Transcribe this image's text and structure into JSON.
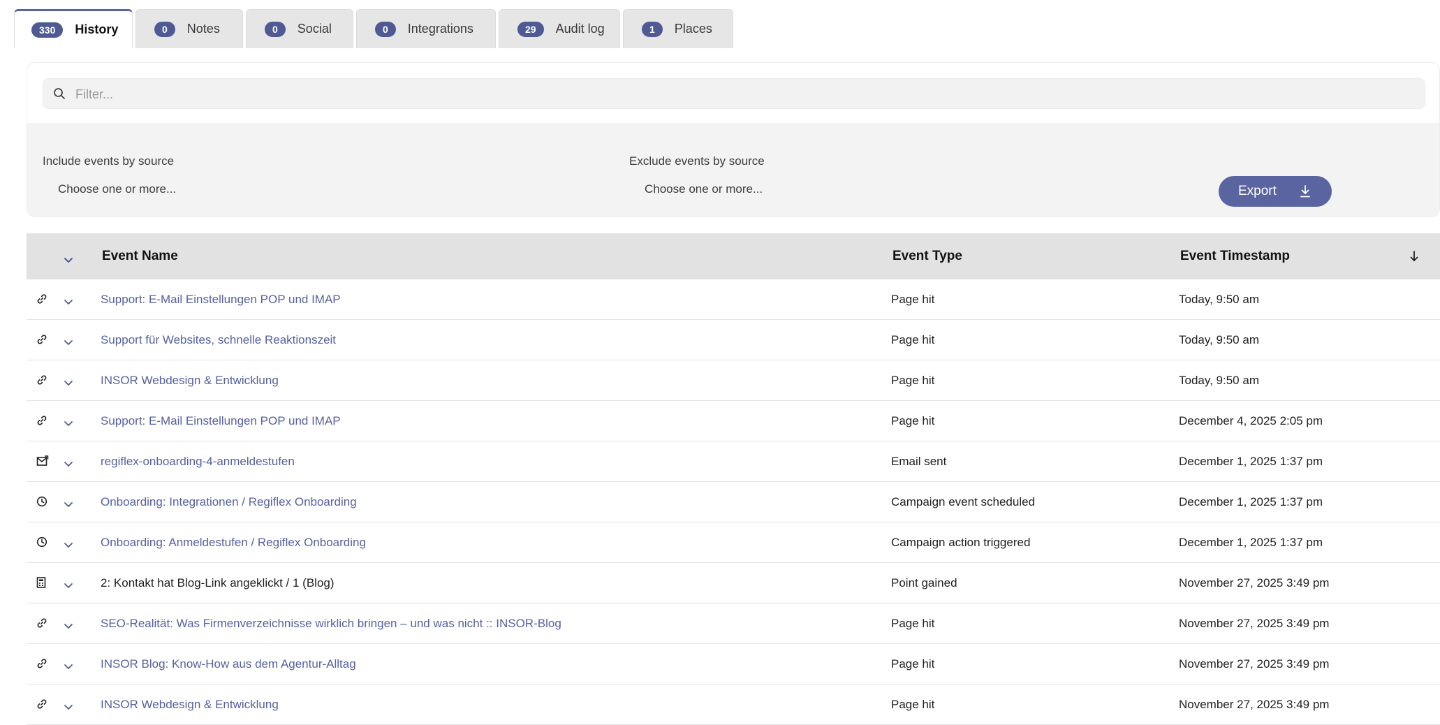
{
  "tabs": [
    {
      "count": "330",
      "label": "History",
      "active": true
    },
    {
      "count": "0",
      "label": "Notes"
    },
    {
      "count": "0",
      "label": "Social"
    },
    {
      "count": "0",
      "label": "Integrations"
    },
    {
      "count": "29",
      "label": "Audit log"
    },
    {
      "count": "1",
      "label": "Places"
    }
  ],
  "filter": {
    "search_placeholder": "Filter...",
    "include_label": "Include events by source",
    "include_placeholder": "Choose one or more...",
    "exclude_label": "Exclude events by source",
    "exclude_placeholder": "Choose one or more...",
    "export_label": "Export"
  },
  "table": {
    "headers": {
      "name": "Event Name",
      "type": "Event Type",
      "timestamp": "Event Timestamp"
    },
    "rows": [
      {
        "icon": "link-icon",
        "name": "Support: E-Mail Einstellungen POP und IMAP",
        "link": true,
        "type": "Page hit",
        "timestamp": "Today, 9:50 am"
      },
      {
        "icon": "link-icon",
        "name": "Support für Websites, schnelle Reaktionszeit",
        "link": true,
        "type": "Page hit",
        "timestamp": "Today, 9:50 am"
      },
      {
        "icon": "link-icon",
        "name": "INSOR Webdesign & Entwicklung",
        "link": true,
        "type": "Page hit",
        "timestamp": "Today, 9:50 am"
      },
      {
        "icon": "link-icon",
        "name": "Support: E-Mail Einstellungen POP und IMAP",
        "link": true,
        "type": "Page hit",
        "timestamp": "December 4, 2025 2:05 pm"
      },
      {
        "icon": "email-sent-icon",
        "name": "regiflex-onboarding-4-anmeldestufen",
        "link": true,
        "type": "Email sent",
        "timestamp": "December 1, 2025 1:37 pm"
      },
      {
        "icon": "clock-icon",
        "name": "Onboarding: Integrationen / Regiflex Onboarding",
        "link": true,
        "type": "Campaign event scheduled",
        "timestamp": "December 1, 2025 1:37 pm"
      },
      {
        "icon": "clock-icon",
        "name": "Onboarding: Anmeldestufen / Regiflex Onboarding",
        "link": true,
        "type": "Campaign action triggered",
        "timestamp": "December 1, 2025 1:37 pm"
      },
      {
        "icon": "calculator-icon",
        "name": "2: Kontakt hat Blog-Link angeklickt / 1 (Blog)",
        "link": false,
        "type": "Point gained",
        "timestamp": "November 27, 2025 3:49 pm"
      },
      {
        "icon": "link-icon",
        "name": "SEO-Realität: Was Firmenverzeichnisse wirklich bringen – und was nicht :: INSOR-Blog",
        "link": true,
        "type": "Page hit",
        "timestamp": "November 27, 2025 3:49 pm"
      },
      {
        "icon": "link-icon",
        "name": "INSOR Blog: Know-How aus dem Agentur-Alltag",
        "link": true,
        "type": "Page hit",
        "timestamp": "November 27, 2025 3:49 pm"
      },
      {
        "icon": "link-icon",
        "name": "INSOR Webdesign & Entwicklung",
        "link": true,
        "type": "Page hit",
        "timestamp": "November 27, 2025 3:49 pm"
      }
    ]
  },
  "colors": {
    "accent": "#5a64a0",
    "link": "#5661a0",
    "header_bg": "#e2e2e2"
  }
}
